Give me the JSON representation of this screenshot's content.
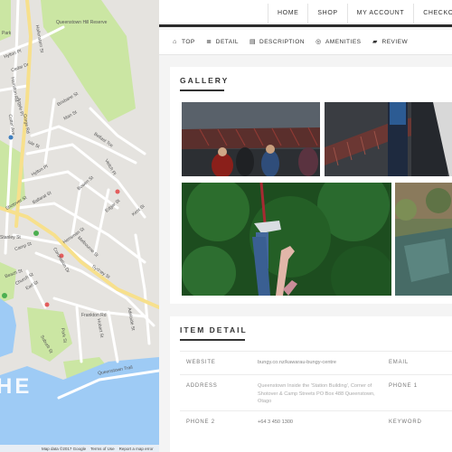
{
  "map": {
    "big_label": "HE",
    "streets": [
      "Park",
      "Hylton Pl",
      "Cedar Dr",
      "Hallenstein St",
      "Queenstown Hill Reserve",
      "Brisbane St",
      "Man St",
      "Hamilton Rd",
      "Isle St",
      "Argyle Pl",
      "Cotter Ave",
      "Gorge Rd",
      "Hylton Pl",
      "Lomond Cres",
      "Frankton Rd",
      "Henry St",
      "Ballarat St",
      "Shotover St",
      "Beach St",
      "Church St",
      "Earl St",
      "Marine Pde",
      "Stanley St",
      "Camp St",
      "Coronation Dr",
      "Melbourne St",
      "Edgar St",
      "Kent St",
      "Sydney St",
      "Robins Rd",
      "Suburb St",
      "Frankton Rd",
      "Adelaide St",
      "Hobart St",
      "Park St",
      "Queenstown Trail",
      "Hensman St",
      "Bowen St",
      "Veitch Pl",
      "Belfast Tce"
    ],
    "footer": {
      "data": "Map data ©2017 Google",
      "terms": "Terms of Use",
      "report": "Report a map error"
    }
  },
  "topnav": {
    "items": [
      "HOME",
      "SHOP",
      "MY ACCOUNT",
      "CHECKOUT"
    ]
  },
  "subnav": {
    "items": [
      {
        "label": "TOP",
        "icon": "home-icon"
      },
      {
        "label": "DETAIL",
        "icon": "list-icon"
      },
      {
        "label": "DESCRIPTION",
        "icon": "document-icon"
      },
      {
        "label": "AMENITIES",
        "icon": "target-icon"
      },
      {
        "label": "REVIEW",
        "icon": "comment-icon"
      }
    ]
  },
  "gallery": {
    "title": "GALLERY"
  },
  "detail": {
    "title": "ITEM DETAIL",
    "rows": [
      {
        "label": "WEBSITE",
        "value": "bungy.co.nz/kawarau-bungy-centre",
        "label2": "EMAIL"
      },
      {
        "label": "ADDRESS",
        "value": "Queenstown Inside the 'Station Building', Corner of Shotover & Camp Streets PO Box 488 Queenstown, Otago",
        "label2": "PHONE 1"
      },
      {
        "label": "PHONE 2",
        "value": "+64 3 450 1300",
        "label2": "KEYWORD"
      }
    ]
  },
  "colors": {
    "map_land": "#e5e3df",
    "map_water": "#9ecbf5",
    "map_park": "#cbe6a3",
    "map_road": "#ffffff",
    "map_highway": "#f7e08c",
    "nav_border": "#2b2b2b"
  }
}
